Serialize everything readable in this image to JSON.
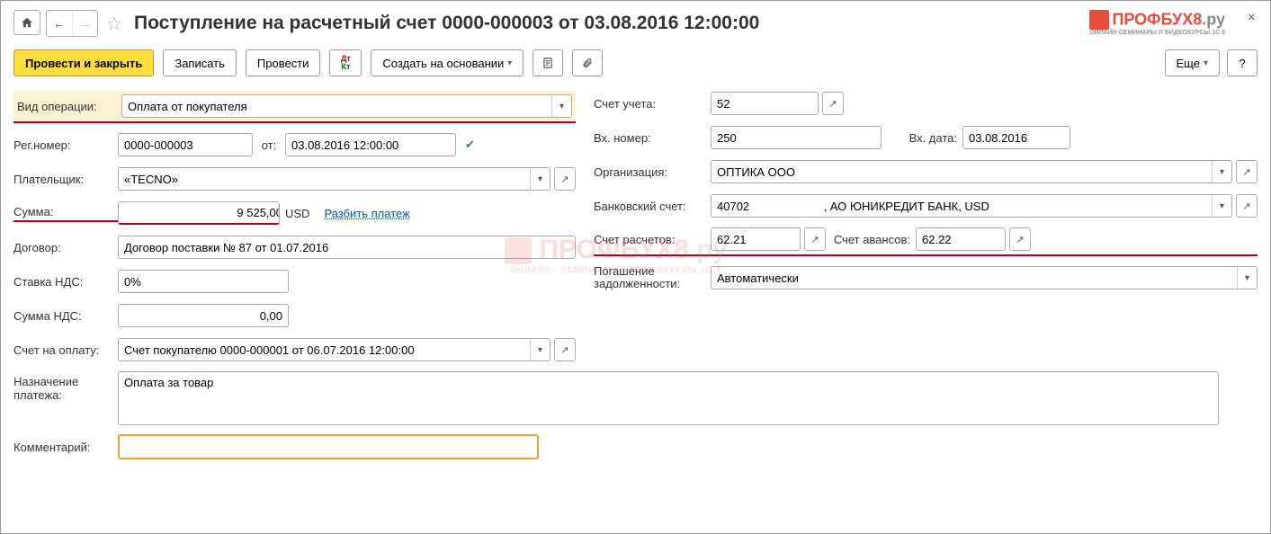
{
  "title": "Поступление на расчетный счет 0000-000003 от 03.08.2016 12:00:00",
  "toolbar": {
    "post_and_close": "Провести и закрыть",
    "save": "Записать",
    "post": "Провести",
    "create_based": "Создать на основании",
    "more": "Еще",
    "help": "?"
  },
  "labels": {
    "op_type": "Вид операции:",
    "reg_no": "Рег.номер:",
    "from": "от:",
    "payer": "Плательщик:",
    "sum": "Сумма:",
    "split": "Разбить платеж",
    "contract": "Договор:",
    "vat_rate": "Ставка НДС:",
    "vat_sum": "Сумма НДС:",
    "invoice": "Счет на оплату:",
    "purpose": "Назначение платежа:",
    "comment": "Комментарий:",
    "account": "Счет учета:",
    "inc_no": "Вх. номер:",
    "inc_date": "Вх. дата:",
    "org": "Организация:",
    "bank_acc": "Банковский счет:",
    "settle_acc": "Счет расчетов:",
    "advance_acc": "Счет авансов:",
    "debt_repay": "Погашение задолженности:"
  },
  "values": {
    "op_type": "Оплата от покупателя",
    "reg_no": "0000-000003",
    "reg_date": "03.08.2016 12:00:00",
    "payer": "«TECNO»",
    "sum": "9 525,00",
    "currency": "USD",
    "contract": "Договор поставки № 87 от 01.07.2016",
    "vat_rate": "0%",
    "vat_sum": "0,00",
    "invoice": "Счет покупателю 0000-000001 от 06.07.2016 12:00:00",
    "purpose": "Оплата за товар",
    "comment": "",
    "account": "52",
    "inc_no": "250",
    "inc_date": "03.08.2016",
    "org": "ОПТИКА ООО",
    "bank_acc": "40702                       ‚ АО ЮНИКРЕДИТ БАНК, USD",
    "settle_acc": "62.21",
    "advance_acc": "62.22",
    "debt_repay": "Автоматически"
  },
  "logo": {
    "brand": "ПРОФБУХ8",
    "suffix": ".ру",
    "tag": "ОНЛАЙН СЕМИНАРЫ И ВИДЕОКУРСЫ 1С 8"
  }
}
